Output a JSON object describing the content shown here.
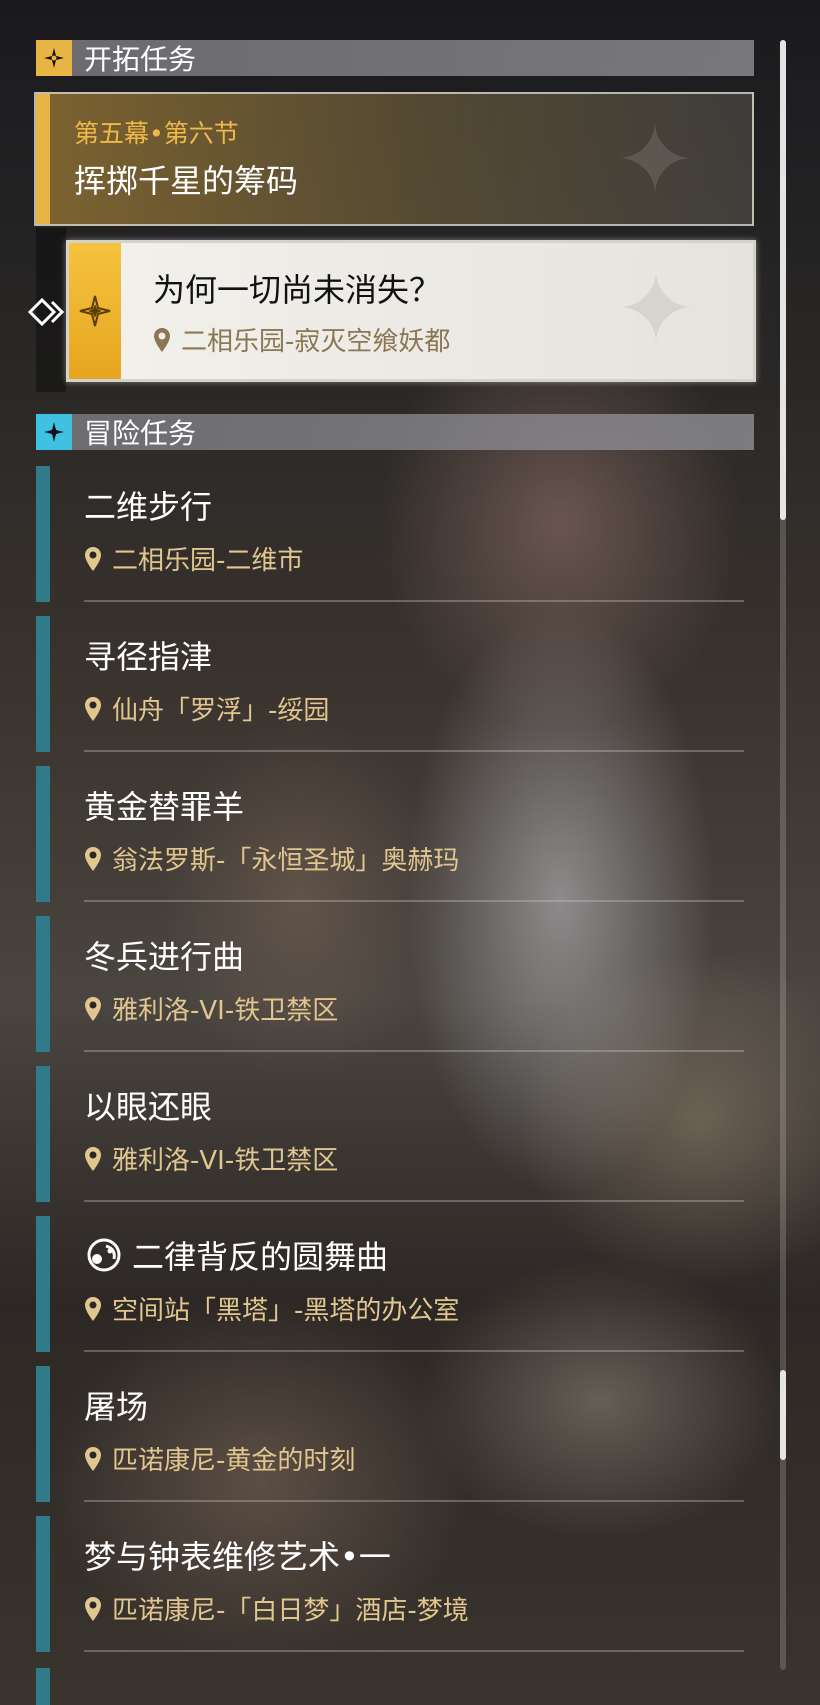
{
  "trailblaze_section": {
    "icon": "trailblaze-icon",
    "title": "开拓任务",
    "quest": {
      "chapter": "第五幕•第六节",
      "title": "挥掷千星的筹码"
    }
  },
  "active_quest": {
    "title": "为何一切尚未消失？",
    "location": "二相乐园-寂灭空飨妖都"
  },
  "adventure_section": {
    "icon": "adventure-icon",
    "title": "冒险任务",
    "items": [
      {
        "title": "二维步行",
        "location": "二相乐园-二维市"
      },
      {
        "title": "寻径指津",
        "location": "仙舟「罗浮」-绥园"
      },
      {
        "title": "黄金替罪羊",
        "location": "翁法罗斯-「永恒圣城」奥赫玛"
      },
      {
        "title": "冬兵进行曲",
        "location": "雅利洛-VI-铁卫禁区"
      },
      {
        "title": "以眼还眼",
        "location": "雅利洛-VI-铁卫禁区"
      },
      {
        "title": "二律背反的圆舞曲",
        "location": "空间站「黑塔」-黑塔的办公室",
        "icon": "special-event-icon"
      },
      {
        "title": "屠场",
        "location": "匹诺康尼-黄金的时刻"
      },
      {
        "title": "梦与钟表维修艺术•一",
        "location": "匹诺康尼-「白日梦」酒店-梦境"
      }
    ]
  },
  "colors": {
    "gold": "#e8b443",
    "cyan": "#3fc2e2",
    "adventure_bar": "#2f7b8a",
    "location_text": "#e1c78f"
  }
}
